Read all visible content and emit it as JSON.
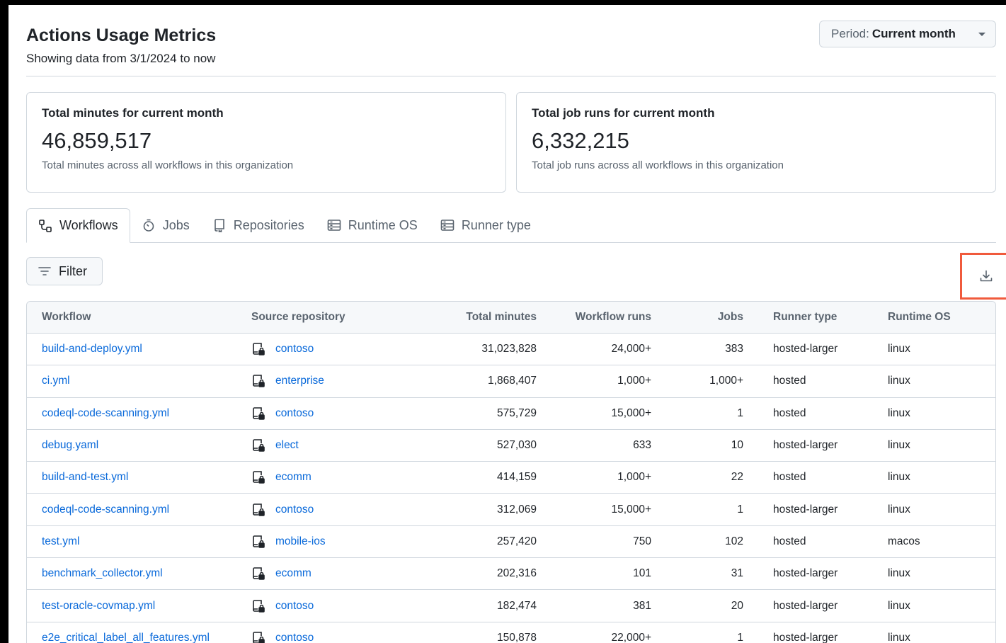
{
  "header": {
    "title": "Actions Usage Metrics",
    "subtitle": "Showing data from 3/1/2024 to now",
    "period_label": "Period:",
    "period_value": "Current month"
  },
  "cards": [
    {
      "title": "Total minutes for current month",
      "value": "46,859,517",
      "description": "Total minutes across all workflows in this organization"
    },
    {
      "title": "Total job runs for current month",
      "value": "6,332,215",
      "description": "Total job runs across all workflows in this organization"
    }
  ],
  "tabs": [
    {
      "label": "Workflows",
      "icon": "workflow-icon",
      "active": true
    },
    {
      "label": "Jobs",
      "icon": "stopwatch-icon",
      "active": false
    },
    {
      "label": "Repositories",
      "icon": "repo-icon",
      "active": false
    },
    {
      "label": "Runtime OS",
      "icon": "server-icon",
      "active": false
    },
    {
      "label": "Runner type",
      "icon": "server-icon",
      "active": false
    }
  ],
  "toolbar": {
    "filter_label": "Filter",
    "download_icon": "download-icon"
  },
  "table": {
    "columns": [
      "Workflow",
      "Source repository",
      "Total minutes",
      "Workflow runs",
      "Jobs",
      "Runner type",
      "Runtime OS"
    ],
    "rows": [
      {
        "workflow": "build-and-deploy.yml",
        "repo": "contoso",
        "minutes": "31,023,828",
        "runs": "24,000+",
        "jobs": "383",
        "runner": "hosted-larger",
        "os": "linux"
      },
      {
        "workflow": "ci.yml",
        "repo": "enterprise",
        "minutes": "1,868,407",
        "runs": "1,000+",
        "jobs": "1,000+",
        "runner": "hosted",
        "os": "linux"
      },
      {
        "workflow": "codeql-code-scanning.yml",
        "repo": "contoso",
        "minutes": "575,729",
        "runs": "15,000+",
        "jobs": "1",
        "runner": "hosted",
        "os": "linux"
      },
      {
        "workflow": "debug.yaml",
        "repo": "elect",
        "minutes": "527,030",
        "runs": "633",
        "jobs": "10",
        "runner": "hosted-larger",
        "os": "linux"
      },
      {
        "workflow": "build-and-test.yml",
        "repo": "ecomm",
        "minutes": "414,159",
        "runs": "1,000+",
        "jobs": "22",
        "runner": "hosted",
        "os": "linux"
      },
      {
        "workflow": "codeql-code-scanning.yml",
        "repo": "contoso",
        "minutes": "312,069",
        "runs": "15,000+",
        "jobs": "1",
        "runner": "hosted-larger",
        "os": "linux"
      },
      {
        "workflow": "test.yml",
        "repo": "mobile-ios",
        "minutes": "257,420",
        "runs": "750",
        "jobs": "102",
        "runner": "hosted",
        "os": "macos"
      },
      {
        "workflow": "benchmark_collector.yml",
        "repo": "ecomm",
        "minutes": "202,316",
        "runs": "101",
        "jobs": "31",
        "runner": "hosted-larger",
        "os": "linux"
      },
      {
        "workflow": "test-oracle-covmap.yml",
        "repo": "contoso",
        "minutes": "182,474",
        "runs": "381",
        "jobs": "20",
        "runner": "hosted-larger",
        "os": "linux"
      },
      {
        "workflow": "e2e_critical_label_all_features.yml",
        "repo": "contoso",
        "minutes": "150,878",
        "runs": "22,000+",
        "jobs": "1",
        "runner": "hosted-larger",
        "os": "linux"
      }
    ]
  },
  "colors": {
    "link": "#0969da",
    "border": "#d0d7de",
    "muted": "#59636e",
    "highlight": "#f05a3c"
  }
}
